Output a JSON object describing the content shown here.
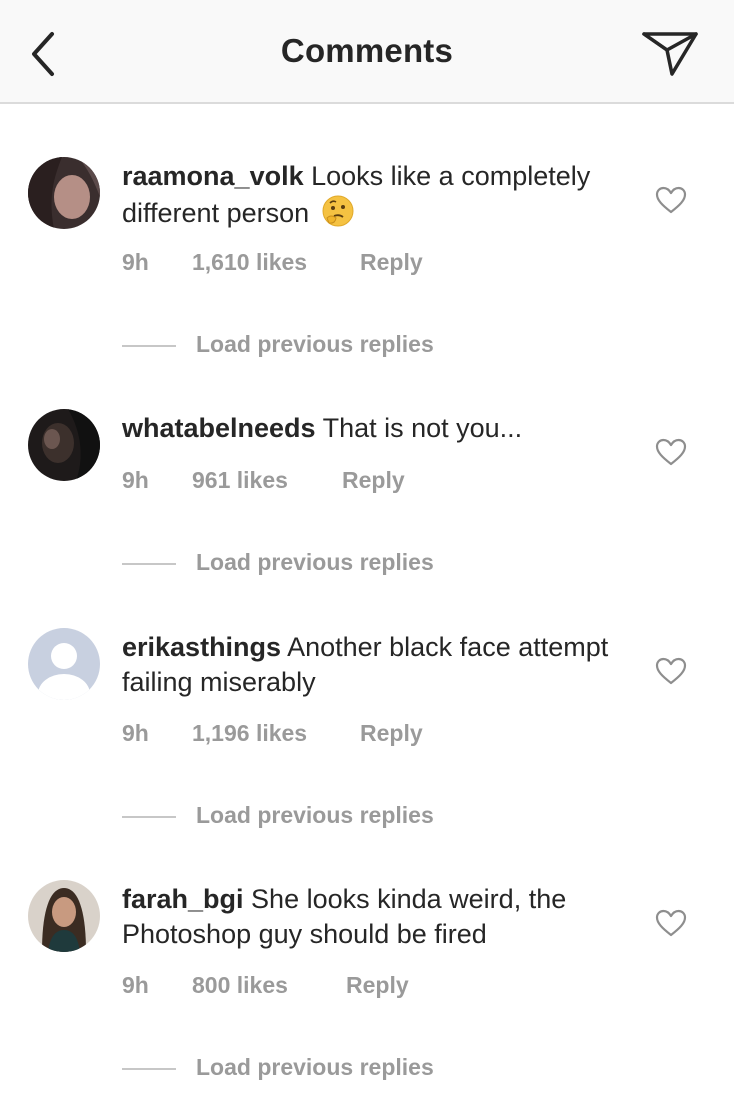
{
  "header": {
    "title": "Comments",
    "back_icon": "chevron-left-icon",
    "share_icon": "paper-plane-icon"
  },
  "comments": [
    {
      "username": "raamona_volk",
      "text": "Looks like a completely different person",
      "emoji": "thinking-face",
      "time": "9h",
      "likes": "1,610 likes",
      "reply": "Reply",
      "load_previous": "Load previous replies"
    },
    {
      "username": "whatabelneeds",
      "text": "That is not you...",
      "time": "9h",
      "likes": "961 likes",
      "reply": "Reply",
      "load_previous": "Load previous replies"
    },
    {
      "username": "erikasthings",
      "text": "Another black face attempt failing miserably",
      "time": "9h",
      "likes": "1,196 likes",
      "reply": "Reply",
      "load_previous": "Load previous replies"
    },
    {
      "username": "farah_bgi",
      "text": "She looks kinda weird, the Photoshop guy should be fired",
      "time": "9h",
      "likes": "800 likes",
      "reply": "Reply",
      "load_previous": "Load previous replies"
    }
  ],
  "colors": {
    "text": "#262626",
    "muted": "#9a9a9a",
    "divider": "#dbdbdb",
    "header_bg": "#f9f9f9"
  }
}
